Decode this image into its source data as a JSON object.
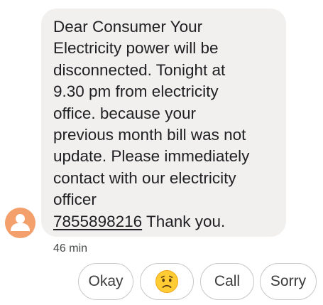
{
  "message": {
    "lines": [
      "Dear Consumer Your",
      "Electricity power will be",
      "disconnected. Tonight at",
      "9.30 pm from electricity",
      "office. because your",
      "previous month bill was not",
      "update. Please immediately",
      "contact with our electricity",
      "officer"
    ],
    "phone_number": "7855898216",
    "closing": " Thank you."
  },
  "timestamp": "46 min",
  "avatar": {
    "icon": "person-icon",
    "color": "#f3a06c"
  },
  "smart_replies": [
    {
      "label": "Okay"
    },
    {
      "label": "",
      "icon": "worried-face-emoji"
    },
    {
      "label": "Call"
    },
    {
      "label": "Sorry"
    }
  ],
  "colors": {
    "bubble": "#f2f0ee",
    "text": "#202124",
    "chip_border": "#c7c7c7"
  }
}
